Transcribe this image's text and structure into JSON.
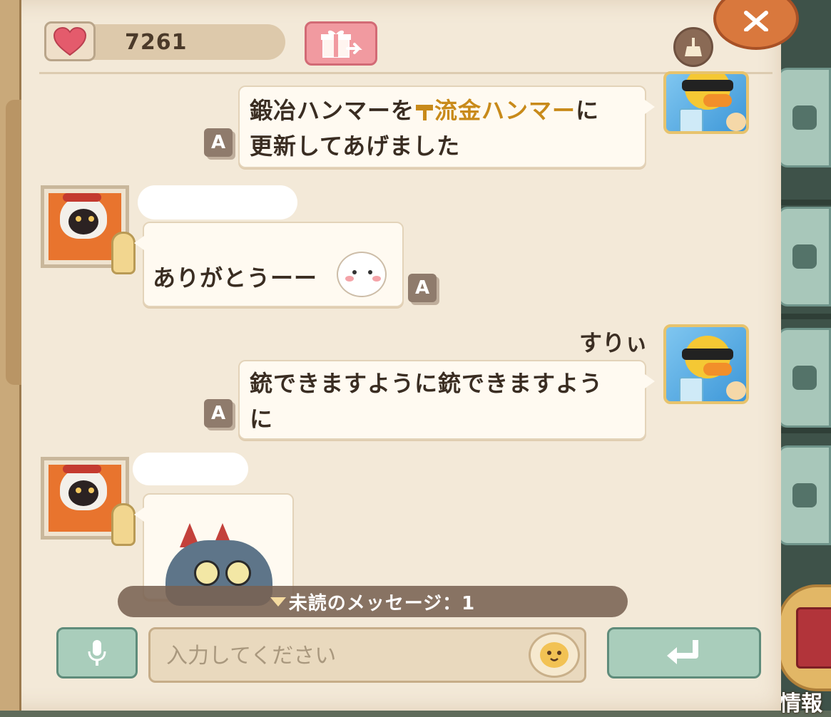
{
  "header": {
    "heart_icon": "heart-icon",
    "like_count": "7261",
    "gift_icon": "gift-send-icon",
    "clear_icon": "broom-icon",
    "close_icon": "close-icon"
  },
  "messages": [
    {
      "side": "right",
      "sender_name": "",
      "text_part1": "鍛冶ハンマーを",
      "highlight": "流金ハンマー",
      "text_part2": "に",
      "text_line2": "更新してあげました",
      "badge": "A"
    },
    {
      "side": "left",
      "sender_name": "",
      "text": "ありがとうーー",
      "badge": "A"
    },
    {
      "side": "right",
      "sender_name": "すりぃ",
      "text_line1": "銃できますように銃できますよう",
      "text_line2": "に",
      "badge": "A"
    },
    {
      "side": "left",
      "sender_name": "",
      "sticker": "shark-sticker"
    }
  ],
  "unread": {
    "label": "未読のメッセージ：1"
  },
  "input": {
    "placeholder": "入力してください",
    "value": ""
  },
  "sidebar": {
    "info_label": "情報"
  },
  "colors": {
    "parchment": "#f3e9d8",
    "accent_green": "#a9cdbb",
    "highlight_gold": "#c88a1a",
    "gift_pink": "#f19aa0"
  }
}
